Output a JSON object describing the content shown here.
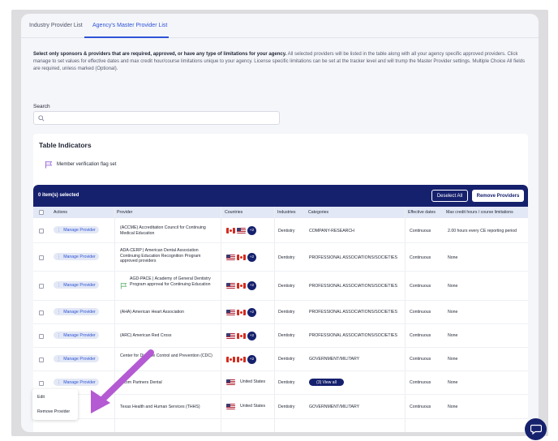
{
  "tabs": [
    {
      "label": "Industry Provider List",
      "active": false
    },
    {
      "label": "Agency's Master Provider List",
      "active": true
    }
  ],
  "intro": {
    "bold": "Select only sponsors & providers that are required, approved, or have any type of limitations for your agency.",
    "text": " All selected providers will be listed in the table along with all your agency specific approved providers. Click manage to set values for effective dates and max credit hour/course limitations unique to your agency. License specific limitations can be set at the tracker level and will trump the Master Provider settings. Multiple Choice All fields are required, unless marked (Optional)."
  },
  "search": {
    "label": "Search",
    "placeholder": ""
  },
  "indicators": {
    "title": "Table Indicators",
    "items": [
      {
        "icon": "flag-icon",
        "label": "Member verification flag set"
      }
    ]
  },
  "selection_bar": {
    "count_text": "0 item(s) selected",
    "deselect_label": "Deselect All",
    "remove_label": "Remove Providers"
  },
  "table": {
    "headers": [
      "Actions",
      "Provider",
      "Countries",
      "Industries",
      "Categories",
      "Effective dates",
      "Max credit hours / course limitations"
    ],
    "manage_label": "Manage Provider",
    "rows": [
      {
        "provider": "(ACCME) Accreditation Council for Continuing Medical Education",
        "countries": [
          "ca",
          "us"
        ],
        "more": "+2",
        "industry": "Dentistry",
        "category": "COMPANY-RESEARCH",
        "effective": "Continuous",
        "limit": "2.00 hours every CE reporting period"
      },
      {
        "provider": "ADA-CERP | American Dental Association Continuing Education Recognition Program approved providers",
        "countries": [
          "us",
          "ca"
        ],
        "more": "+2",
        "industry": "Dentistry",
        "category": "PROFESSIONAL ASSOCIATIONS/SOCIETIES",
        "effective": "Continuous",
        "limit": "None"
      },
      {
        "provider": "AGD-PACE | Academy of General Dentistry Program approval for Continuing Education",
        "countries": [
          "us",
          "ca"
        ],
        "more": "+2",
        "industry": "Dentistry",
        "category": "PROFESSIONAL ASSOCIATIONS/SOCIETIES",
        "effective": "Continuous",
        "limit": "None",
        "flagged": true
      },
      {
        "provider": "(AHA) American Heart Association",
        "countries": [
          "us",
          "ca"
        ],
        "more": "+2",
        "industry": "Dentistry",
        "category": "PROFESSIONAL ASSOCIATIONS/SOCIETIES",
        "effective": "Continuous",
        "limit": "None"
      },
      {
        "provider": "(ARC) American Red Cross",
        "countries": [
          "us",
          "ca"
        ],
        "more": "+2",
        "industry": "Dentistry",
        "category": "PROFESSIONAL ASSOCIATIONS/SOCIETIES",
        "effective": "Continuous",
        "limit": "None"
      },
      {
        "provider": "Center for Disease Control and Prevention (CDC)",
        "countries": [
          "ca",
          "ca"
        ],
        "more": "+2",
        "industry": "Dentistry",
        "category": "GOVERNMENT/MILITARY",
        "effective": "Continuous",
        "limit": "None"
      },
      {
        "provider": "Incom Partners Dental",
        "countries": [
          "us"
        ],
        "country_text": "United States",
        "industry": "Dentistry",
        "category_button": "(3) View all",
        "effective": "Continuous",
        "limit": "None"
      },
      {
        "provider": "Texas Health and Human Services (THHS)",
        "countries": [
          "us"
        ],
        "country_text": "United States",
        "industry": "Dentistry",
        "category": "GOVERNMENT/MILITARY",
        "effective": "Continuous",
        "limit": "None"
      }
    ]
  },
  "context_menu": {
    "items": [
      "Edit",
      "Remove Provider"
    ]
  },
  "colors": {
    "navy": "#16216e",
    "accent": "#2e53d6",
    "annotation_arrow": "#b45ad3"
  }
}
